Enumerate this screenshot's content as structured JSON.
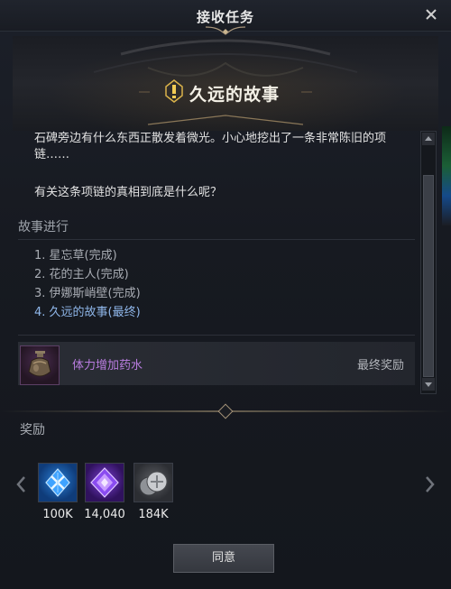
{
  "window": {
    "title": "接收任务",
    "close_icon": "close-icon"
  },
  "quest": {
    "title": "久远的故事",
    "icon": "quest-exclamation-icon",
    "story_lines": [
      "石碑旁边有什么东西正散发着微光。小心地挖出了一条非常陈旧的项",
      "链……",
      "有关这条项链的真相到底是什么呢？"
    ]
  },
  "progress": {
    "label": "故事进行",
    "items": [
      {
        "text": "1. 星忘草(完成)"
      },
      {
        "text": "2. 花的主人(完成)"
      },
      {
        "text": "3. 伊娜斯峭壁(完成)"
      },
      {
        "text": "4. 久远的故事(最终)"
      }
    ]
  },
  "final_reward": {
    "name": "体力增加药水",
    "label": "最终奖励",
    "icon": "potion-icon",
    "name_color": "#b97de0"
  },
  "rewards": {
    "label": "奖励",
    "items": [
      {
        "icon": "blue-crystal-icon",
        "count": "100K"
      },
      {
        "icon": "purple-gem-icon",
        "count": "14,040"
      },
      {
        "icon": "silver-coins-icon",
        "count": "184K"
      }
    ]
  },
  "buttons": {
    "agree": "同意"
  },
  "colors": {
    "accent_blue": "#8fb7ea",
    "rare_purple": "#b97de0",
    "gold_ornament": "#a8957a"
  }
}
